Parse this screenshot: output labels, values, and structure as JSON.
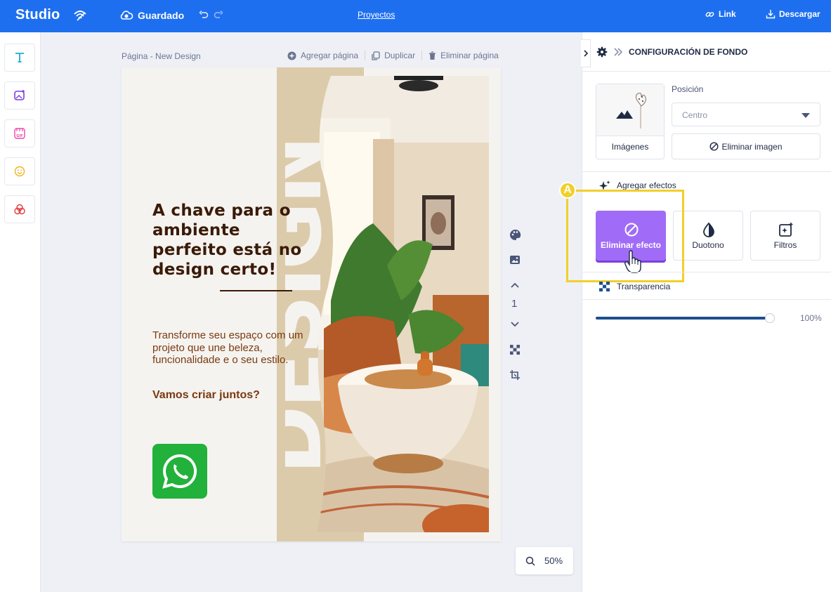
{
  "topbar": {
    "brand": "Studio",
    "saved_label": "Guardado",
    "projects_label": "Proyectos",
    "link_label": "Link",
    "download_label": "Descargar"
  },
  "left_tools": [
    "text-tool",
    "image-tool",
    "gif-tool",
    "emoji-tool",
    "shapes-tool"
  ],
  "canvas": {
    "page_label": "Página - New Design",
    "add_page": "Agregar página",
    "duplicate": "Duplicar",
    "delete_page": "Eliminar página",
    "page_number": "1",
    "zoom": "50%"
  },
  "design": {
    "headline": "A chave para o ambiente perfeito está no design certo!",
    "body": "Transforme seu espaço com um projeto que une beleza, funcionalidade e o seu estilo.",
    "cta": "Vamos criar juntos?",
    "background_word": "DESIGN"
  },
  "panel": {
    "title": "CONFIGURACIÓN DE FONDO",
    "images_label": "Imágenes",
    "position_label": "Posición",
    "position_value": "Centro",
    "remove_image": "Eliminar imagen",
    "effects_title": "Agregar efectos",
    "effects": [
      {
        "label": "Eliminar efecto",
        "active": true
      },
      {
        "label": "Duotono",
        "active": false
      },
      {
        "label": "Filtros",
        "active": false
      }
    ],
    "transparency_title": "Transparencia",
    "transparency_value": "100%",
    "transparency_level": 1.0
  },
  "annotation": {
    "badge": "A"
  },
  "colors": {
    "topbar": "#1e6ff0",
    "accent_effect": "#a06cf7",
    "highlight": "#f2cf2a",
    "headline": "#3a1a07",
    "body": "#7a3a10",
    "beige": "#dccbaa",
    "whatsapp": "#22b13b"
  }
}
